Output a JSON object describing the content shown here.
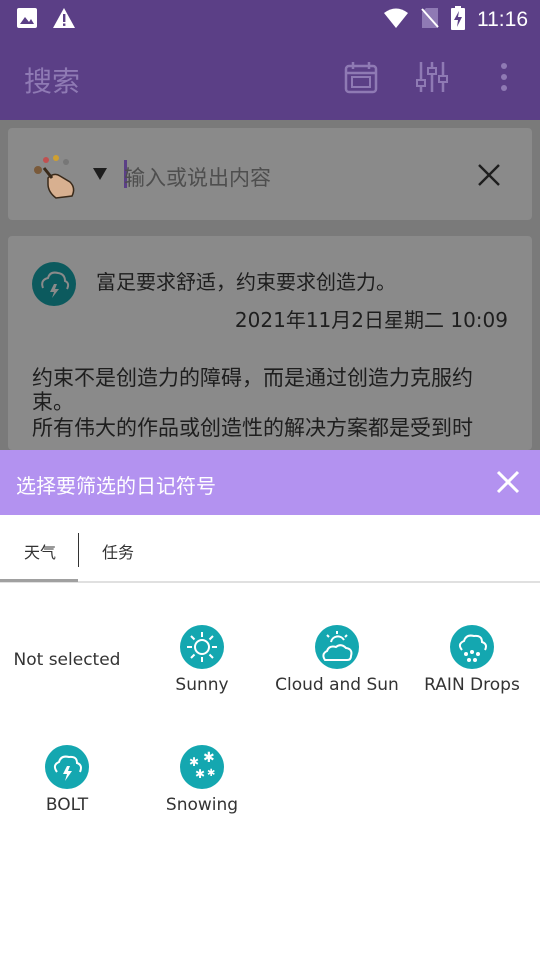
{
  "statusbar": {
    "time": "11:16"
  },
  "appbar": {
    "title": "搜索"
  },
  "search": {
    "placeholder": "输入或说出内容"
  },
  "entry": {
    "title": "富足要求舒适，约束要求创造力。",
    "datetime": "2021年11月2日星期二 10:09",
    "body_line1": "约束不是创造力的障碍，而是通过创造力克服约",
    "body_line2": "束。",
    "body_line3": "所有伟大的作品或创造性的解决方案都是受到时"
  },
  "sheet": {
    "title": "选择要筛选的日记符号",
    "tabs": [
      "天气",
      "任务"
    ],
    "not_selected": "Not selected",
    "weather_items": [
      "Sunny",
      "Cloud and Sun",
      "RAIN Drops",
      "BOLT",
      "Snowing"
    ],
    "icon_color": "#14a7b0",
    "header_color": "#b392f0"
  }
}
